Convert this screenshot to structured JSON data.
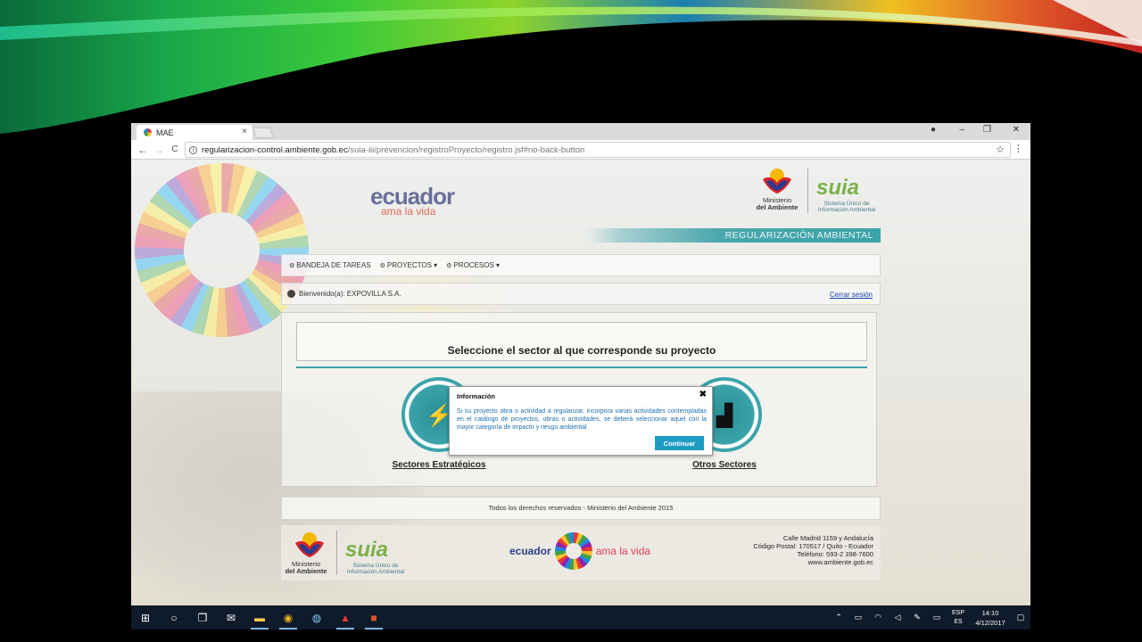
{
  "browser": {
    "tab_title": "MAE",
    "tab_close": "×",
    "url_host": "regularizacion-control.ambiente.gob.ec",
    "url_path": "/suia-iii/prevencion/registroProyecto/registro.jsf#no-back-button",
    "back": "←",
    "forward": "→",
    "reload": "C",
    "star": "☆",
    "menu": "⋮",
    "minimize": "–",
    "restore": "❐",
    "close": "✕",
    "profile": "●"
  },
  "header": {
    "ecuador_word": "ecuador",
    "ecuador_tagline": "ama la vida",
    "mae_name_1": "Ministerio",
    "mae_name_2": "del Ambiente",
    "suia_word": "suia",
    "suia_sub": "Sistema Único de Información Ambiental",
    "regularizacion": "REGULARIZACIÓN AMBIENTAL"
  },
  "menu": {
    "items": [
      "BANDEJA DE TAREAS",
      "PROYECTOS ▾",
      "PROCESOS ▾"
    ]
  },
  "welcome": {
    "text": "Bienvenido(a): EXPOVILLA S.A.",
    "logout": "Cerrar sesión"
  },
  "main": {
    "title": "Seleccione el sector al que corresponde su proyecto",
    "sector_1": "Sectores Estratégicos",
    "sector_2": "Otros Sectores"
  },
  "footer": {
    "rights": "Todos los derechos reservados - Ministerio del Ambiente 2015",
    "ecuador_word": "ecuador",
    "ecuador_tagline": "ama la vida",
    "mae_name_1": "Ministerio",
    "mae_name_2": "del Ambiente",
    "suia_word": "suia",
    "suia_sub": "Sistema Único de Información Ambiental",
    "address_1": "Calle Madrid 1159 y Andalucía",
    "address_2": "Código Postal: 170517 / Quito - Ecuador",
    "address_3": "Teléfono: 593-2 398-7600",
    "address_4": "www.ambiente.gob.ec"
  },
  "modal": {
    "title": "Información",
    "close": "✖",
    "body": "Si su proyecto obra o actividad a regularizar, incorpora varias actividades contempladas en el catálogo de proyectos, obras o actividades, se deberá seleccionar aquel con la mayor categoría de impacto y riesgo ambiental",
    "button": "Continuar"
  },
  "taskbar": {
    "lang_1": "ESP",
    "lang_2": "ES",
    "time": "14:10",
    "date": "4/12/2017"
  },
  "colors": {
    "accent": "#3aa3aa",
    "button": "#1f9cc3",
    "link": "#1a3fb0"
  }
}
